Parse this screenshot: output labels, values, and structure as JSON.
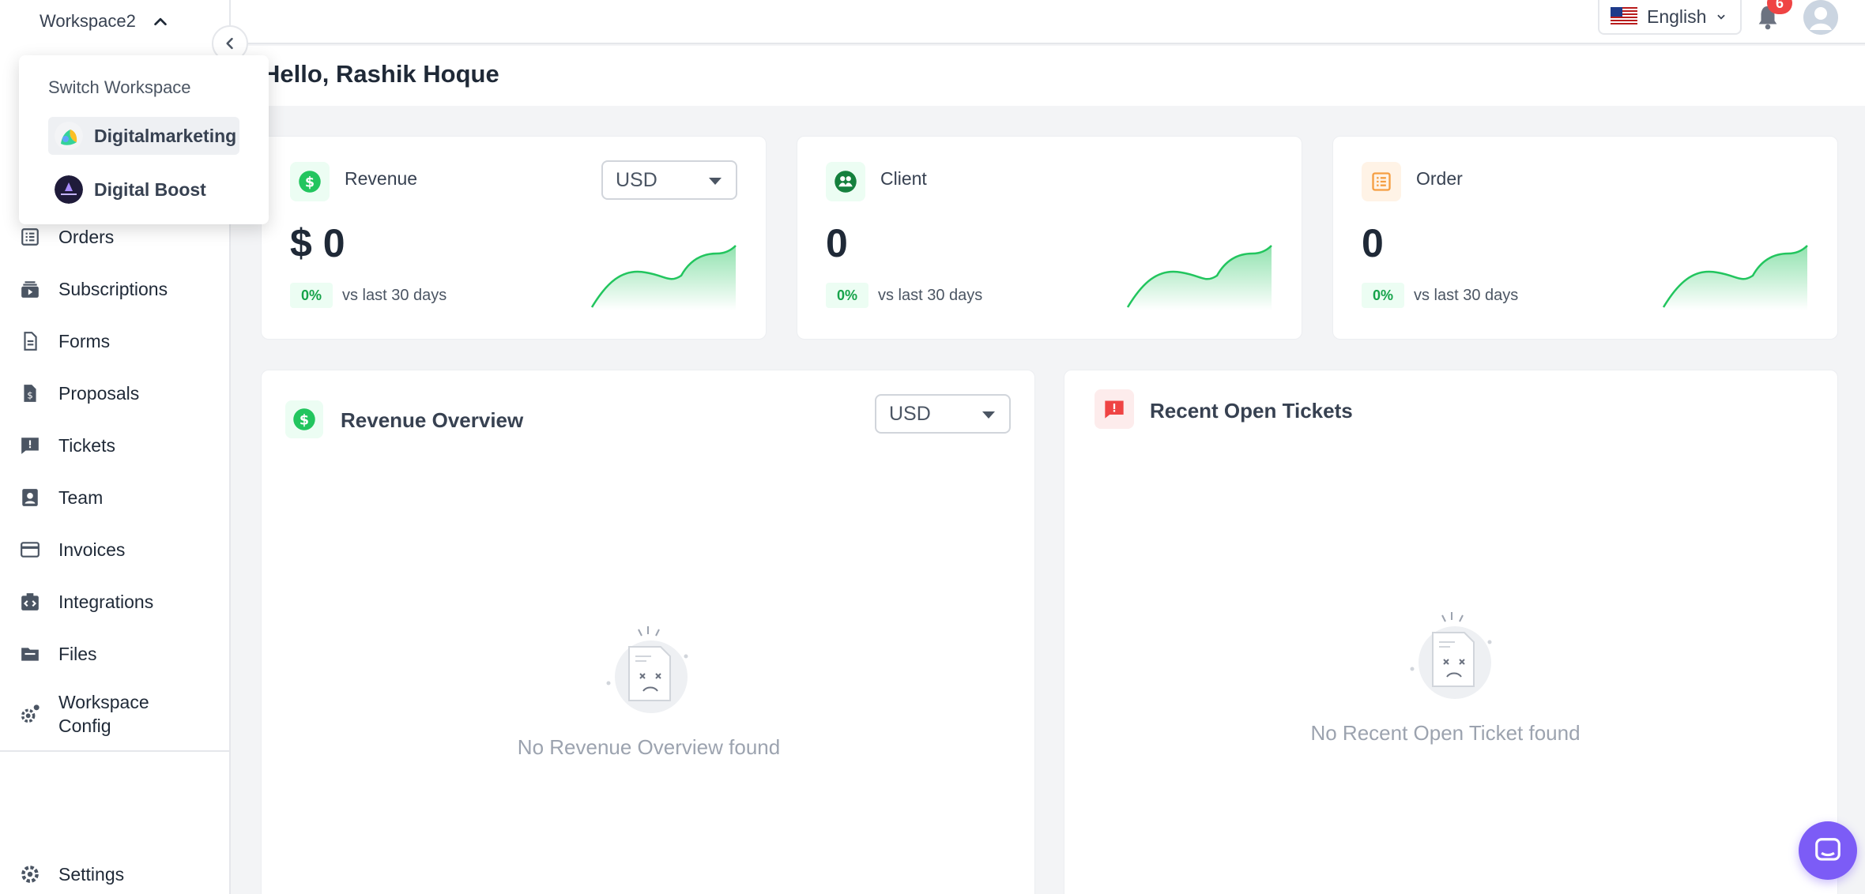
{
  "workspace": {
    "current": "Workspace2",
    "menu_title": "Switch Workspace",
    "options": [
      {
        "label": "Digitalmarketing",
        "active": true
      },
      {
        "label": "Digital Boost",
        "active": false
      }
    ]
  },
  "sidebar": {
    "items": [
      {
        "label": "Orders",
        "icon": "list-icon"
      },
      {
        "label": "Subscriptions",
        "icon": "subscriptions-icon"
      },
      {
        "label": "Forms",
        "icon": "document-icon"
      },
      {
        "label": "Proposals",
        "icon": "proposal-icon"
      },
      {
        "label": "Tickets",
        "icon": "ticket-icon"
      },
      {
        "label": "Team",
        "icon": "team-icon"
      },
      {
        "label": "Invoices",
        "icon": "card-icon"
      },
      {
        "label": "Integrations",
        "icon": "integrations-icon"
      },
      {
        "label": "Files",
        "icon": "folder-icon"
      },
      {
        "label": "Workspace Config",
        "icon": "gears-icon"
      }
    ],
    "settings_label": "Settings"
  },
  "topbar": {
    "language": "English",
    "notification_count": "6"
  },
  "greeting": "Hello, Rashik Hoque",
  "stats": [
    {
      "title": "Revenue",
      "value": "$ 0",
      "pct": "0%",
      "compare": "vs last 30 days",
      "currency": "USD",
      "icon": "dollar-icon"
    },
    {
      "title": "Client",
      "value": "0",
      "pct": "0%",
      "compare": "vs last 30 days",
      "icon": "client-icon"
    },
    {
      "title": "Order",
      "value": "0",
      "pct": "0%",
      "compare": "vs last 30 days",
      "icon": "order-icon"
    }
  ],
  "revenue_overview": {
    "title": "Revenue Overview",
    "currency": "USD",
    "empty_text": "No Revenue Overview found"
  },
  "recent_tickets": {
    "title": "Recent Open Tickets",
    "empty_text": "No Recent Open Ticket found"
  },
  "colors": {
    "accent_green": "#16a34a",
    "spark_green": "#22c55e",
    "ticket_red": "#ef4444",
    "order_orange": "#f59e42",
    "chat_purple": "#7c5cf6"
  }
}
